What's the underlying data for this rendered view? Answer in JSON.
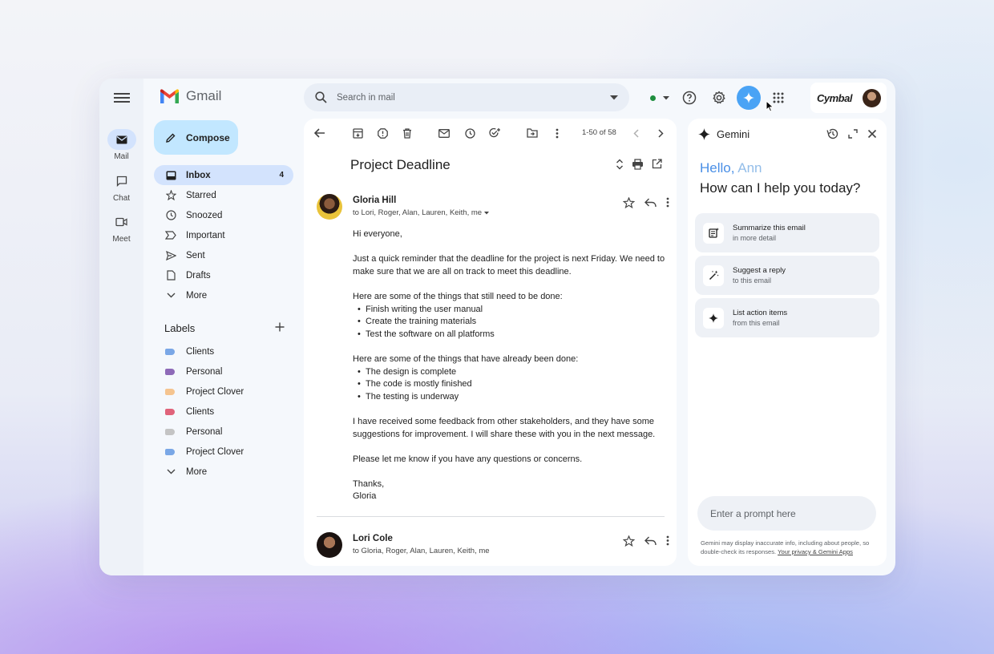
{
  "app": {
    "name": "Gmail"
  },
  "rail": [
    {
      "label": "Mail",
      "icon": "mail-icon"
    },
    {
      "label": "Chat",
      "icon": "chat-icon"
    },
    {
      "label": "Meet",
      "icon": "video-icon"
    }
  ],
  "compose_label": "Compose",
  "nav": [
    {
      "label": "Inbox",
      "count": "4",
      "icon": "inbox-icon"
    },
    {
      "label": "Starred",
      "icon": "star-icon"
    },
    {
      "label": "Snoozed",
      "icon": "clock-icon"
    },
    {
      "label": "Important",
      "icon": "important-icon"
    },
    {
      "label": "Sent",
      "icon": "send-icon"
    },
    {
      "label": "Drafts",
      "icon": "draft-icon"
    },
    {
      "label": "More",
      "icon": "chevron-down-icon"
    }
  ],
  "labels_title": "Labels",
  "labels": [
    {
      "label": "Clients",
      "color": "#7aa7e6"
    },
    {
      "label": "Personal",
      "color": "#8e6ab8"
    },
    {
      "label": "Project Clover",
      "color": "#f5c48f"
    },
    {
      "label": "Clients",
      "color": "#e0637a"
    },
    {
      "label": "Personal",
      "color": "#c4c4c4"
    },
    {
      "label": "Project Clover",
      "color": "#7aa7e6"
    },
    {
      "label": "More"
    }
  ],
  "search": {
    "placeholder": "Search in mail"
  },
  "account": {
    "brand": "Cymbal"
  },
  "toolbar": {
    "pager": "1-50 of 58"
  },
  "email": {
    "subject": "Project Deadline",
    "messages": [
      {
        "sender": "Gloria Hill",
        "to": "to Lori, Roger, Alan, Lauren, Keith, me",
        "greeting": "Hi everyone,",
        "p1": "Just a quick reminder that the deadline for the project is next Friday. We need to make sure that we are all on track to meet this deadline.",
        "todo_intro": "Here are some of the things that still need to be done:",
        "todo": [
          "Finish writing the user manual",
          "Create the training materials",
          "Test the software on all platforms"
        ],
        "done_intro": "Here are some of the things that have already been done:",
        "done": [
          "The design is complete",
          "The code is mostly finished",
          "The testing is underway"
        ],
        "p2": "I have received some feedback from other stakeholders, and they have some suggestions for improvement. I will share these with you in the next message.",
        "p3": "Please let me know if you have any questions or concerns.",
        "signoff": "Thanks,",
        "signature": "Gloria"
      },
      {
        "sender": "Lori Cole",
        "to": "to Gloria, Roger, Alan, Lauren, Keith, me"
      }
    ]
  },
  "gemini": {
    "title": "Gemini",
    "hello": "Hello,",
    "name": "Ann",
    "question": "How can I help you today?",
    "cards": [
      {
        "title": "Summarize this email",
        "sub": "in more detail",
        "icon": "summarize-icon"
      },
      {
        "title": "Suggest a reply",
        "sub": "to this email",
        "icon": "magic-wand-icon"
      },
      {
        "title": "List action items",
        "sub": "from this email",
        "icon": "sparkle-icon"
      }
    ],
    "prompt_placeholder": "Enter a prompt here",
    "disclaimer": "Gemini may display inaccurate info, including about people, so double-check its responses.",
    "privacy_link": "Your privacy & Gemini Apps"
  }
}
